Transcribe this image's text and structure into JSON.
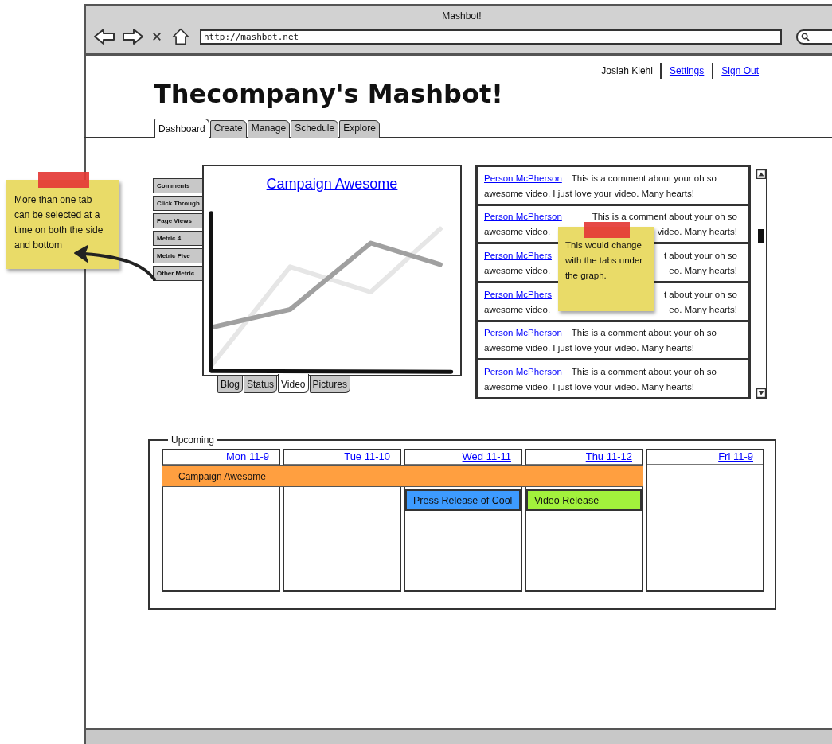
{
  "window": {
    "title": "Mashbot!"
  },
  "address_bar": {
    "value": "http://mashbot.net"
  },
  "user_menu": {
    "user": "Josiah Kiehl",
    "links": [
      "Settings",
      "Sign Out"
    ]
  },
  "heading": "Thecompany's Mashbot!",
  "nav_tabs": [
    {
      "label": "Dashboard",
      "selected": true
    },
    {
      "label": "Create",
      "selected": false
    },
    {
      "label": "Manage",
      "selected": false
    },
    {
      "label": "Schedule",
      "selected": false
    },
    {
      "label": "Explore",
      "selected": false
    }
  ],
  "chart_panel": {
    "title": "Campaign Awesome",
    "side_tabs": [
      {
        "label": "Comments",
        "selected": false
      },
      {
        "label": "Click Through",
        "selected": false
      },
      {
        "label": "Page Views",
        "selected": false
      },
      {
        "label": "Metric 4",
        "selected": false
      },
      {
        "label": "Metric Five",
        "selected": false
      },
      {
        "label": "Other Metric",
        "selected": false
      }
    ],
    "bottom_tabs": [
      {
        "label": "Blog",
        "selected": false
      },
      {
        "label": "Status",
        "selected": false
      },
      {
        "label": "Video",
        "selected": true
      },
      {
        "label": "Pictures",
        "selected": false
      }
    ]
  },
  "comments": [
    {
      "author": "Person McPherson",
      "covered": false,
      "lines": [
        [
          "This is a comment about your oh so"
        ],
        [
          "awesome video. I just love your video. Many hearts!"
        ]
      ]
    },
    {
      "author": "Person McPherson",
      "covered": true,
      "lines": [
        [
          "This is a comment about your oh so"
        ],
        [
          "awesome video.",
          "video. Many hearts!"
        ]
      ]
    },
    {
      "author": "Person McPhers",
      "covered": true,
      "lines": [
        [
          "t about your oh so"
        ],
        [
          "awesome video.",
          "eo. Many hearts!"
        ]
      ]
    },
    {
      "author": "Person McPhers",
      "covered": true,
      "lines": [
        [
          "t about your oh so"
        ],
        [
          "awesome video.",
          "eo. Many hearts!"
        ]
      ]
    },
    {
      "author": "Person McPherson",
      "covered": false,
      "lines": [
        [
          "This is a comment about your oh so"
        ],
        [
          "awesome video. I just love your video. Many hearts!"
        ]
      ]
    },
    {
      "author": "Person McPherson",
      "covered": false,
      "lines": [
        [
          "This is a comment about your oh so"
        ],
        [
          "awesome video. I just love your video. Many hearts!"
        ]
      ]
    }
  ],
  "upcoming": {
    "title": "Upcoming",
    "days": [
      {
        "label": "Mon 11-9",
        "link": false,
        "slots": [
          {
            "kind": "event",
            "title": "Campaign Awesome",
            "color": "#ff9f40"
          }
        ]
      },
      {
        "label": "Tue 11-10",
        "link": false,
        "slots": [
          {
            "kind": "continued"
          }
        ]
      },
      {
        "label": "Wed 11-11",
        "link": true,
        "slots": [
          {
            "kind": "continued"
          },
          {
            "kind": "event",
            "title": "Press Release of Cool",
            "color": "#3d9bff"
          }
        ]
      },
      {
        "label": "Thu 11-12",
        "link": true,
        "slots": [
          {
            "kind": "continued"
          },
          {
            "kind": "event",
            "title": "Video Release",
            "color": "#a2f23c"
          }
        ]
      },
      {
        "label": "Fri 11-9",
        "link": true
      }
    ]
  },
  "notes": [
    {
      "text": "More than one tab can be selected at a time on both the side and bottom"
    },
    {
      "text": "This would change with the tabs under the graph."
    }
  ]
}
